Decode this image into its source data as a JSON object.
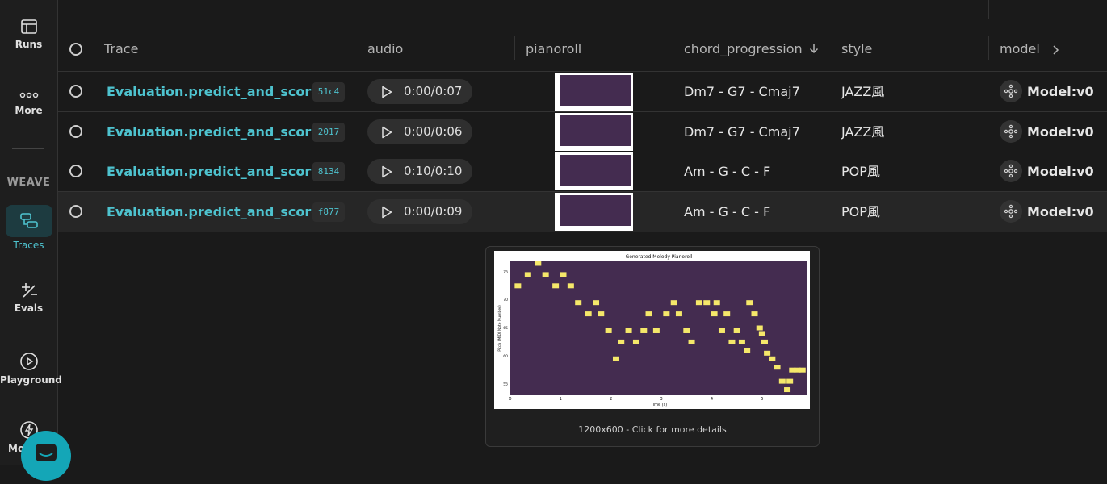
{
  "sidebar": {
    "runs": "Runs",
    "more": "More",
    "weave": "WEAVE",
    "traces": "Traces",
    "evals": "Evals",
    "playground": "Playground",
    "monitors": "Mo"
  },
  "table": {
    "headers": {
      "trace": "Trace",
      "audio": "audio",
      "pianoroll": "pianoroll",
      "chord": "chord_progression",
      "style": "style",
      "model": "model"
    },
    "rows": [
      {
        "name": "Evaluation.predict_and_score",
        "id": "51c4",
        "audio": "0:00/0:07",
        "chord": "Dm7 - G7 - Cmaj7",
        "style": "JAZZ風",
        "model": "Model:v0"
      },
      {
        "name": "Evaluation.predict_and_score",
        "id": "2017",
        "audio": "0:00/0:06",
        "chord": "Dm7 - G7 - Cmaj7",
        "style": "JAZZ風",
        "model": "Model:v0"
      },
      {
        "name": "Evaluation.predict_and_score",
        "id": "8134",
        "audio": "0:10/0:10",
        "chord": "Am - G - C - F",
        "style": "POP風",
        "model": "Model:v0"
      },
      {
        "name": "Evaluation.predict_and_score",
        "id": "f877",
        "audio": "0:00/0:09",
        "chord": "Am - G - C - F",
        "style": "POP風",
        "model": "Model:v0"
      }
    ]
  },
  "popover": {
    "caption": "1200x600 - Click for more details",
    "chart_data": {
      "type": "scatter",
      "title": "Generated Melody Pianoroll",
      "xlabel": "Time (s)",
      "ylabel": "Pitch (MIDI Note Number)",
      "xlim": [
        0,
        5.9
      ],
      "ylim": [
        53,
        77
      ],
      "xticks": [
        "0",
        "1",
        "2",
        "3",
        "4",
        "5"
      ],
      "yticks": [
        "55",
        "60",
        "65",
        "70",
        "75"
      ],
      "x": [
        0.15,
        0.35,
        0.55,
        0.7,
        0.9,
        1.05,
        1.2,
        1.35,
        1.55,
        1.7,
        1.8,
        1.95,
        2.1,
        2.2,
        2.35,
        2.5,
        2.65,
        2.75,
        2.9,
        3.1,
        3.25,
        3.35,
        3.5,
        3.6,
        3.75,
        3.9,
        4.05,
        4.1,
        4.2,
        4.3,
        4.4,
        4.5,
        4.6,
        4.7,
        4.75,
        4.85,
        4.95,
        5.0,
        5.05,
        5.1,
        5.2,
        5.3,
        5.4,
        5.5,
        5.55,
        5.6,
        5.7,
        5.8
      ],
      "y": [
        72.5,
        74.5,
        76.5,
        74.5,
        72.5,
        74.5,
        72.5,
        69.5,
        67.5,
        69.5,
        67.5,
        64.5,
        59.5,
        62.5,
        64.5,
        62.5,
        64.5,
        67.5,
        64.5,
        67.5,
        69.5,
        67.5,
        64.5,
        62.5,
        69.5,
        69.5,
        67.5,
        69.5,
        64.5,
        67.5,
        62.5,
        64.5,
        62.5,
        61,
        69.5,
        67.5,
        65,
        64,
        62.5,
        60.5,
        59.5,
        58,
        55.5,
        54,
        55.5,
        57.5,
        57.5,
        57.5
      ],
      "colors": {
        "background": "#442c50",
        "note": "#f5e86a"
      }
    }
  }
}
